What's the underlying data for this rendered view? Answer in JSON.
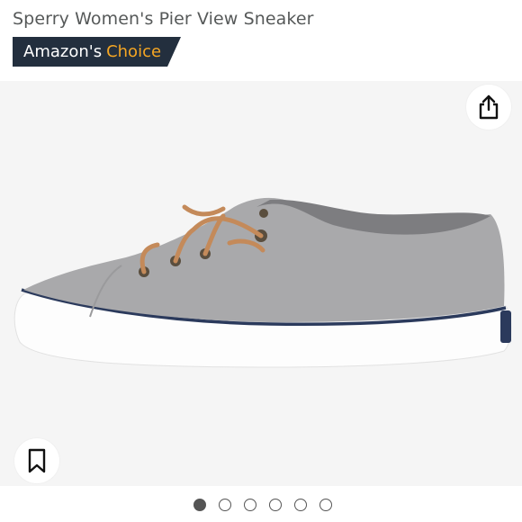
{
  "product": {
    "title": "Sperry Women's Pier View Sneaker"
  },
  "badge": {
    "prefix": "Amazon's",
    "accent": "Choice",
    "background_color": "#232f3e",
    "accent_color": "#f5a623"
  },
  "gallery": {
    "share_icon": "share-icon",
    "save_icon": "bookmark-icon",
    "image_description_icon": "shoe-image",
    "total_images": 6,
    "active_index": 0
  }
}
